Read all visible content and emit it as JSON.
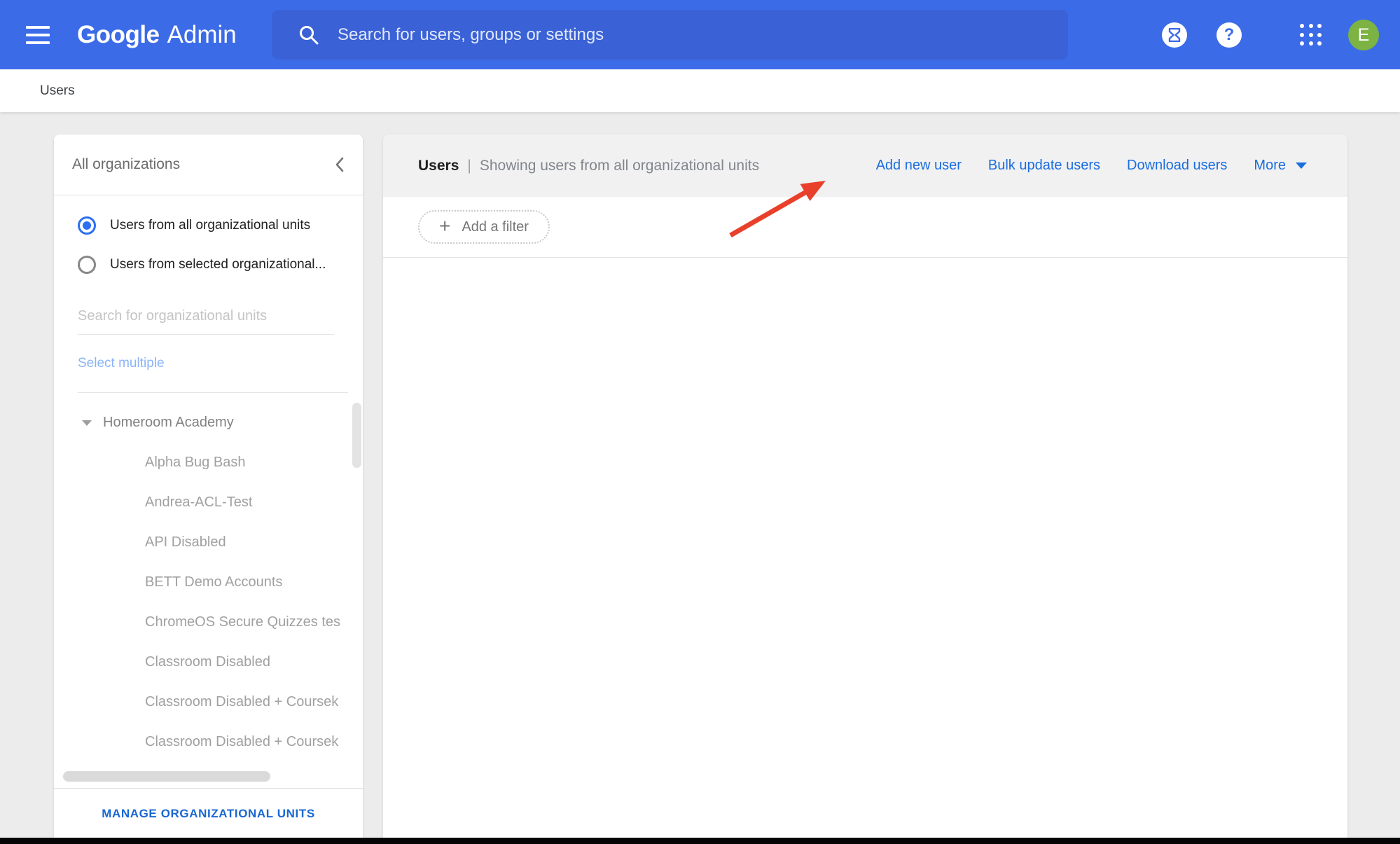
{
  "header": {
    "logo": {
      "google": "Google",
      "admin": "Admin"
    },
    "search_placeholder": "Search for users, groups or settings",
    "help_glyph": "?",
    "avatar_initial": "E"
  },
  "breadcrumb": {
    "label": "Users"
  },
  "sidebar": {
    "title": "All organizations",
    "radios": [
      {
        "label": "Users from all organizational units",
        "selected": true
      },
      {
        "label": "Users from selected organizational...",
        "selected": false
      }
    ],
    "org_search_placeholder": "Search for organizational units",
    "select_multiple": "Select multiple",
    "tree": {
      "root": "Homeroom Academy",
      "children": [
        "Alpha Bug Bash",
        "Andrea-ACL-Test",
        "API Disabled",
        "BETT Demo Accounts",
        "ChromeOS Secure Quizzes tes",
        "Classroom Disabled",
        "Classroom Disabled + Coursek",
        "Classroom Disabled + Coursek"
      ]
    },
    "manage_button": "MANAGE ORGANIZATIONAL UNITS"
  },
  "main": {
    "title": "Users",
    "separator": "|",
    "subtitle": "Showing users from all organizational units",
    "actions": [
      "Add new user",
      "Bulk update users",
      "Download users"
    ],
    "more": "More",
    "filter_plus": "+",
    "filter_button": "Add a filter"
  },
  "colors": {
    "header_blue": "#3c6be8",
    "search_bar_blue": "#3a62d6",
    "link_blue": "#1a6dde",
    "avatar_green": "#7cb342",
    "radio_selected_blue": "#2b6ff3",
    "annotation_arrow_red": "#e8402a"
  },
  "icons": {
    "hamburger_icon": "three-bar-menu",
    "search_icon": "magnifier",
    "hourglass_icon": "hourglass-in-circle",
    "help_icon": "question-mark-in-circle",
    "apps_icon": "3x3-dot-grid",
    "chevron_left_icon": "collapse-panel",
    "caret_down_icon": "expanded-tree-node",
    "more_caret_icon": "dropdown-caret",
    "annotation_arrow": "red-arrow"
  }
}
